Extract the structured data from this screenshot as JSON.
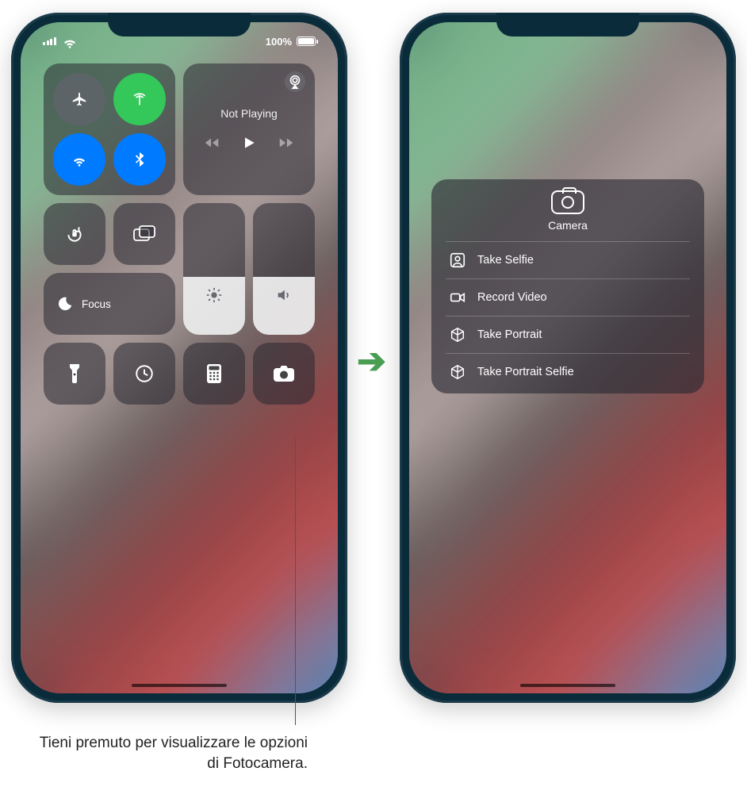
{
  "statusbar": {
    "battery_text": "100%"
  },
  "connectivity": {
    "airplane": false,
    "cellular": true,
    "wifi": true,
    "bluetooth": true
  },
  "media": {
    "title": "Not Playing"
  },
  "focus": {
    "label": "Focus"
  },
  "sliders": {
    "brightness_pct": 44,
    "volume_pct": 44
  },
  "camera_popup": {
    "title": "Camera",
    "items": [
      {
        "label": "Take Selfie",
        "icon": "person-square-icon"
      },
      {
        "label": "Record Video",
        "icon": "video-icon"
      },
      {
        "label": "Take Portrait",
        "icon": "cube-icon"
      },
      {
        "label": "Take Portrait Selfie",
        "icon": "cube-icon"
      }
    ]
  },
  "caption": "Tieni premuto per visualizzare le opzioni di Fotocamera."
}
